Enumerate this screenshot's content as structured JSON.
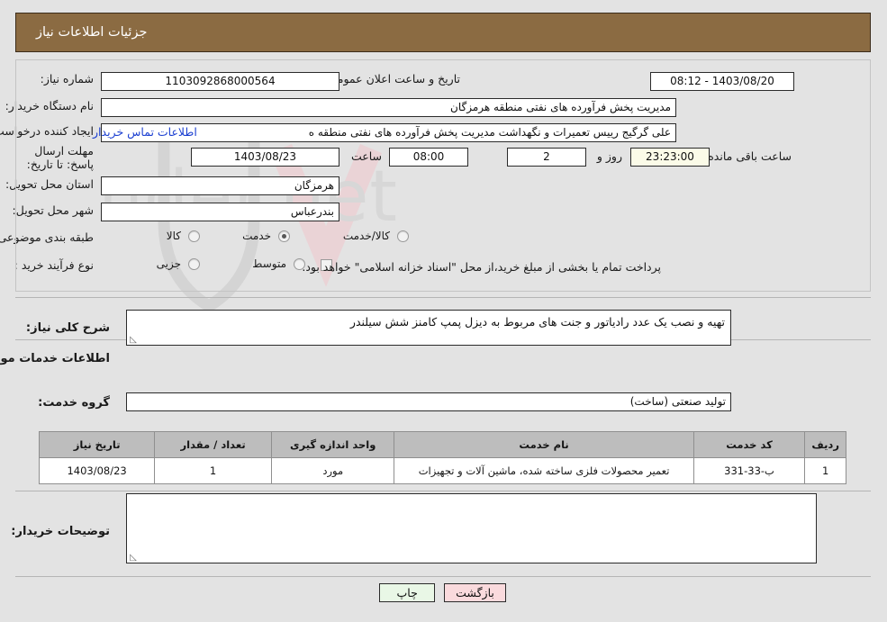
{
  "header": {
    "title": "جزئیات اطلاعات نیاز"
  },
  "form": {
    "need_number_label": "شماره نیاز:",
    "need_number_value": "1103092868000564",
    "announce_label": "تاریخ و ساعت اعلان عمومی:",
    "announce_value": "1403/08/20 - 08:12",
    "buyer_org_label": "نام دستگاه خریدار:",
    "buyer_org_value": "مدیریت پخش فرآورده های نفتی منطقه هرمزگان",
    "creator_label": "ایجاد کننده درخواست:",
    "creator_value": "علی گرگیج رییس تعمیرات و نگهداشت مدیریت پخش فرآورده های نفتی منطقه ه",
    "contact_link": "اطلاعات تماس خریدار",
    "deadline_label": "مهلت ارسال پاسخ: تا تاریخ:",
    "deadline_date": "1403/08/23",
    "hour_label": "ساعت",
    "deadline_time": "08:00",
    "days_value": "2",
    "days_label": "روز و",
    "remaining_value": "23:23:00",
    "remaining_label": "ساعت باقی مانده",
    "province_label": "استان محل تحویل:",
    "province_value": "هرمزگان",
    "city_label": "شهر محل تحویل:",
    "city_value": "بندرعباس",
    "category_label": "طبقه بندی موضوعی:",
    "category_options": [
      {
        "label": "کالا",
        "selected": false
      },
      {
        "label": "خدمت",
        "selected": true
      },
      {
        "label": "کالا/خدمت",
        "selected": false
      }
    ],
    "process_label": "نوع فرآیند خرید :",
    "process_options": [
      {
        "label": "جزیی",
        "selected": false
      },
      {
        "label": "متوسط",
        "selected": false
      }
    ],
    "treasury_checked": false,
    "treasury_note": "پرداخت تمام یا بخشی از مبلغ خرید،از محل \"اسناد خزانه اسلامی\" خواهد بود."
  },
  "description": {
    "label": "شرح کلی نیاز:",
    "value": "تهیه و نصب یک عدد رادیاتور و جنت های مربوط به دیزل پمپ کامنز شش سیلندر"
  },
  "services": {
    "section_title": "اطلاعات خدمات مورد نیاز",
    "group_label": "گروه خدمت:",
    "group_value": "تولید صنعتی (ساخت)",
    "columns": [
      "ردیف",
      "کد خدمت",
      "نام خدمت",
      "واحد اندازه گیری",
      "تعداد / مقدار",
      "تاریخ نیاز"
    ],
    "rows": [
      {
        "radif": "1",
        "code": "ب-33-331",
        "name": "تعمیر محصولات فلزی ساخته شده، ماشین آلات و تجهیزات",
        "unit": "مورد",
        "qty": "1",
        "date": "1403/08/23"
      }
    ]
  },
  "notes": {
    "label": "توضیحات خریدار:",
    "value": ""
  },
  "buttons": {
    "back": "بازگشت",
    "print": "چاپ"
  },
  "watermark": {
    "text": "AriaTender.net"
  },
  "colors": {
    "header_bg": "#8b6b42",
    "link": "#1b3fd1",
    "back_btn": "#fadadd",
    "print_btn": "#e9f7e6",
    "table_header": "#bdbdbd",
    "page_bg": "#e3e3e3"
  }
}
